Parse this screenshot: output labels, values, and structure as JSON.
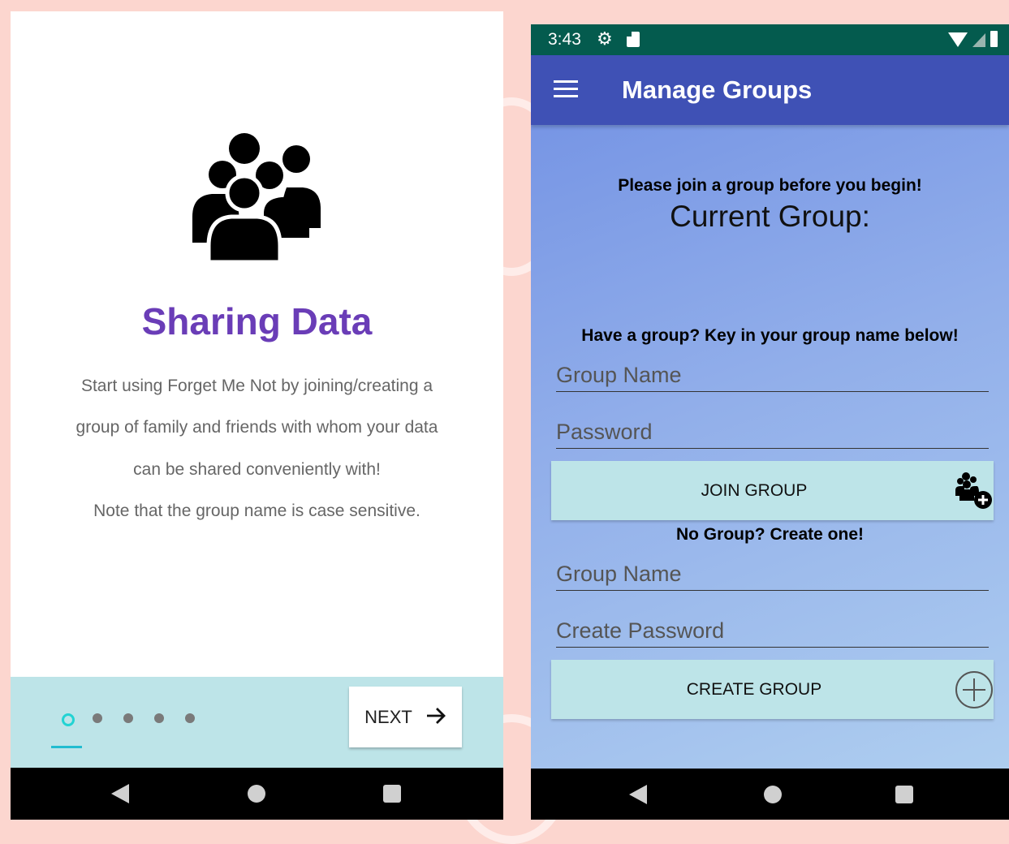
{
  "left_screen": {
    "title": "Sharing Data",
    "description_lines": [
      "Start using Forget Me Not by joining/creating a",
      "group of family and friends with whom your data",
      "can be shared conveniently with!",
      "Note that the group name is case sensitive."
    ],
    "hero_icon": "group-people-icon",
    "pager": {
      "total_dots": 5,
      "current_index": 0
    },
    "next_button_label": "NEXT",
    "next_icon": "arrow-right-icon"
  },
  "right_screen": {
    "status_bar": {
      "time": "3:43",
      "icons": [
        "gear-icon",
        "sd-card-icon",
        "wifi-icon",
        "signal-icon",
        "battery-icon"
      ]
    },
    "toolbar": {
      "title": "Manage Groups",
      "menu_icon": "hamburger-menu-icon"
    },
    "join_prompt": "Please join a group before you begin!",
    "current_group_label": "Current Group:",
    "have_group_prompt": "Have a group? Key in your group name below!",
    "join_group_name_placeholder": "Group Name",
    "join_password_placeholder": "Password",
    "join_button_label": "JOIN GROUP",
    "join_button_icon": "add-group-icon",
    "no_group_prompt": "No Group? Create one!",
    "create_group_name_placeholder": "Group Name",
    "create_password_placeholder": "Create Password",
    "create_button_label": "CREATE GROUP",
    "create_button_icon": "plus-circle-icon"
  },
  "colors": {
    "page_background": "#fcd6cf",
    "title_purple": "#6a3db7",
    "button_teal_light": "#bde4e8",
    "toolbar_indigo": "#3f51b5",
    "status_bar_green": "#045b4e",
    "dot_active_cyan": "#22d3d3"
  }
}
